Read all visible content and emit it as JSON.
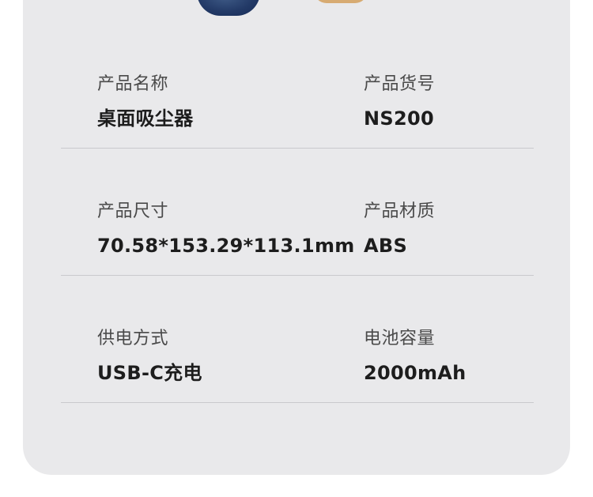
{
  "colors": {
    "card_background": "#e9e9eb",
    "label_text": "#4a4a4a",
    "value_text": "#1d1d1d",
    "divider": "#c9c9cd"
  },
  "specs": [
    {
      "left": {
        "label": "产品名称",
        "value": "桌面吸尘器"
      },
      "right": {
        "label": "产品货号",
        "value": "NS200"
      }
    },
    {
      "left": {
        "label": "产品尺寸",
        "value": "70.58*153.29*113.1mm"
      },
      "right": {
        "label": "产品材质",
        "value": "ABS"
      }
    },
    {
      "left": {
        "label": "供电方式",
        "value": "USB-C充电"
      },
      "right": {
        "label": "电池容量",
        "value": "2000mAh"
      }
    }
  ]
}
